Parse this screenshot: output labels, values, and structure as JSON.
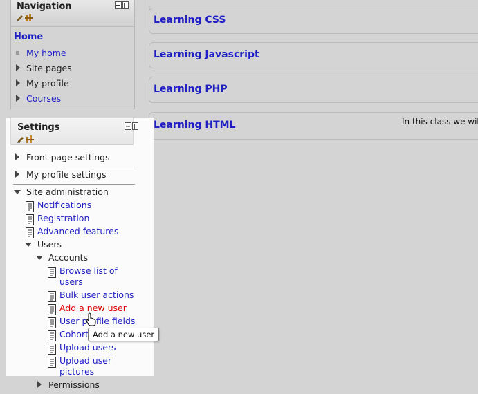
{
  "navigation": {
    "title": "Navigation",
    "home_label": "Home",
    "items": [
      {
        "label": "My home",
        "icon": "bullet-icon",
        "link": true
      },
      {
        "label": "Site pages",
        "icon": "expand-icon",
        "link": false
      },
      {
        "label": "My profile",
        "icon": "expand-icon",
        "link": false
      },
      {
        "label": "Courses",
        "icon": "expand-icon",
        "link": true
      }
    ]
  },
  "settings": {
    "title": "Settings",
    "front_page_settings": "Front page settings",
    "my_profile_settings": "My profile settings",
    "site_administration": "Site administration",
    "notifications": "Notifications",
    "registration": "Registration",
    "advanced_features": "Advanced features",
    "users": "Users",
    "accounts": "Accounts",
    "browse_list_line1": "Browse list of",
    "browse_list_line2": "users",
    "bulk_user_actions": "Bulk user actions",
    "add_new_user": "Add a new user",
    "user_profile_fields": "User profile fields",
    "cohorts": "Cohorts",
    "upload_users": "Upload users",
    "upload_pictures_line1": "Upload user",
    "upload_pictures_line2": "pictures",
    "permissions": "Permissions"
  },
  "tooltip": "Add a new user",
  "courses": [
    {
      "title": "Learning CSS",
      "summary": ""
    },
    {
      "title": "Learning Javascript",
      "summary": ""
    },
    {
      "title": "Learning PHP",
      "summary": ""
    },
    {
      "title": "Learning HTML",
      "summary": "In this class we will t"
    }
  ],
  "colors": {
    "link": "#1f1fc4",
    "hover_link": "#e00000",
    "background": "#d4d4d4"
  }
}
